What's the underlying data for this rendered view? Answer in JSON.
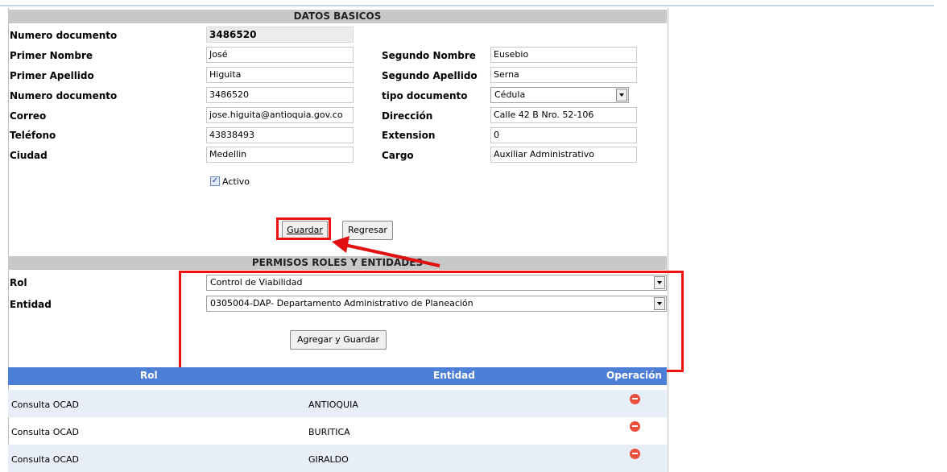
{
  "datos_basicos": {
    "header": "DATOS BASICOS",
    "fields_left": [
      {
        "label": "Numero documento",
        "value": "3486520"
      },
      {
        "label": "Primer Nombre",
        "value": "José"
      },
      {
        "label": "Primer Apellido",
        "value": "Higuita"
      },
      {
        "label": "Numero documento",
        "value": "3486520"
      },
      {
        "label": "Correo",
        "value": "jose.higuita@antioquia.gov.co"
      },
      {
        "label": "Teléfono",
        "value": "43838493"
      },
      {
        "label": "Ciudad",
        "value": "Medellin"
      }
    ],
    "fields_right": [
      {
        "label": "Segundo Nombre",
        "value": "Eusebio"
      },
      {
        "label": "Segundo Apellido",
        "value": "Serna"
      },
      {
        "label": "tipo documento",
        "value": "Cédula"
      },
      {
        "label": "Dirección",
        "value": "Calle 42 B Nro. 52-106"
      },
      {
        "label": "Extension",
        "value": "0"
      },
      {
        "label": "Cargo",
        "value": "Auxiliar Administrativo"
      }
    ],
    "activo_label": "Activo",
    "activo_checked": true,
    "guardar_label": "Guardar",
    "regresar_label": "Regresar"
  },
  "permisos": {
    "header": "PERMISOS ROLES Y ENTIDADES",
    "rol_label": "Rol",
    "rol_value": "Control de Viabilidad",
    "entidad_label": "Entidad",
    "entidad_value": "0305004-DAP- Departamento Administrativo de Planeación",
    "agregar_label": "Agregar y Guardar"
  },
  "table": {
    "headers": [
      "Rol",
      "Entidad",
      "Operación"
    ],
    "rows": [
      {
        "rol": "Consulta OCAD",
        "entidad": "ANTIOQUIA"
      },
      {
        "rol": "Consulta OCAD",
        "entidad": "BURITICA"
      },
      {
        "rol": "Consulta OCAD",
        "entidad": "GIRALDO"
      }
    ]
  },
  "colors": {
    "header_bg": "#c8c8c8",
    "table_header_bg": "#4d7fd6",
    "annotation_red": "#e11111"
  }
}
